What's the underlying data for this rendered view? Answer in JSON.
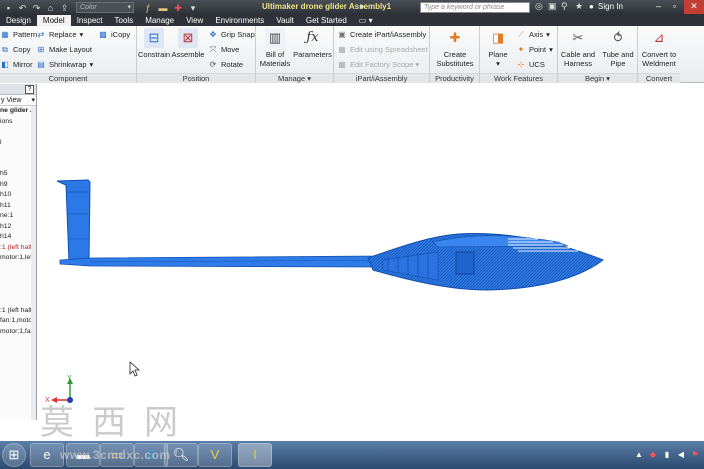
{
  "titlebar": {
    "color_select": "Color",
    "app_title": "Ultimaker drone glider Assembly1",
    "search_placeholder": "Type a keyword or phrase",
    "sign_in": "Sign In",
    "qat_icons": [
      "new-icon",
      "undo-icon",
      "redo-icon",
      "home-icon",
      "return-icon"
    ],
    "tool_icons": [
      "fx-icon",
      "material-icon",
      "appearance-icon",
      "update-icon"
    ]
  },
  "tabs": {
    "items": [
      "Design",
      "Model",
      "Inspect",
      "Tools",
      "Manage",
      "View",
      "Environments",
      "Vault",
      "Get Started"
    ],
    "active": "Model"
  },
  "ribbon": {
    "component": {
      "title": "Component",
      "pattern": "Pattern",
      "copy": "Copy",
      "mirror": "Mirror",
      "replace": "Replace",
      "make_layout": "Make Layout",
      "shrinkwrap": "Shrinkwrap",
      "icopy": "iCopy"
    },
    "position": {
      "title": "Position",
      "constrain": "Constrain",
      "assemble": "Assemble",
      "grip_snap": "Grip Snap",
      "move": "Move",
      "rotate": "Rotate"
    },
    "manage": {
      "title": "Manage",
      "bom_line1": "Bill of",
      "bom_line2": "Materials",
      "parameters": "Parameters"
    },
    "ipart": {
      "title": "iPart/iAssembly",
      "create": "Create iPart/iAssembly",
      "edit_spreadsheet": "Edit using Spreadsheet",
      "edit_factory": "Edit Factory Scope"
    },
    "productivity": {
      "title": "Productivity",
      "create_line1": "Create",
      "create_line2": "Substitutes"
    },
    "work_features": {
      "title": "Work Features",
      "plane": "Plane",
      "axis": "Axis",
      "point": "Point",
      "ucs": "UCS"
    },
    "begin": {
      "title": "Begin",
      "cable_line1": "Cable and",
      "cable_line2": "Harness",
      "tube_line1": "Tube and",
      "tube_line2": "Pipe"
    },
    "convert": {
      "title": "Convert",
      "line1": "Convert to",
      "line2": "Weldment"
    }
  },
  "browser": {
    "view": "y View",
    "tree": [
      "ne glider A",
      "ions",
      "",
      "l",
      "",
      "",
      "h5",
      "h9",
      "h10",
      "h11",
      "ne:1",
      "h12",
      "h14",
      ":1 (left half)",
      "motor:1,left",
      "",
      "",
      "",
      "",
      ":1 (left half)",
      "fan:1,motor",
      "motor:1,fan"
    ]
  },
  "colors": {
    "model_blue": "#1f6fe0",
    "ribbon_bg": "#eef0f3",
    "taskbar": "#3a5a84"
  },
  "watermark": {
    "chars": [
      "莫",
      "西",
      "网"
    ],
    "url": "www.3cmdxc.com"
  },
  "axis_triad": {
    "y": "Y",
    "x": "X"
  }
}
